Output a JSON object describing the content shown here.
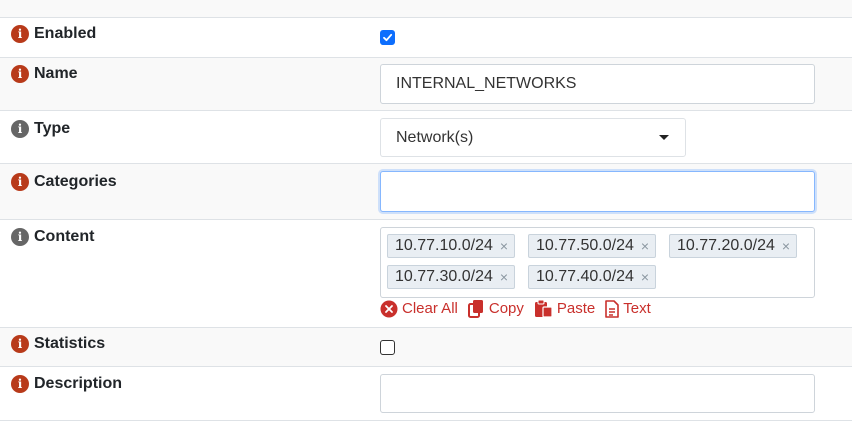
{
  "fields": {
    "enabled": {
      "label": "Enabled",
      "checked": true
    },
    "name": {
      "label": "Name",
      "value": "INTERNAL_NETWORKS"
    },
    "type": {
      "label": "Type",
      "value": "Network(s)"
    },
    "categories": {
      "label": "Categories",
      "value": ""
    },
    "content": {
      "label": "Content",
      "tags": [
        "10.77.10.0/24",
        "10.77.50.0/24",
        "10.77.20.0/24",
        "10.77.30.0/24",
        "10.77.40.0/24"
      ],
      "remove_glyph": "×",
      "actions": {
        "clear_all": "Clear All",
        "copy": "Copy",
        "paste": "Paste",
        "text": "Text"
      }
    },
    "statistics": {
      "label": "Statistics",
      "checked": false
    },
    "description": {
      "label": "Description",
      "value": ""
    }
  },
  "colors": {
    "info_red": "#b83a1a",
    "info_grey": "#666666",
    "action_red": "#c9302c",
    "checkbox_blue": "#0d6efd"
  },
  "icons": {
    "info": "info-circle-icon",
    "clear_all": "x-circle-icon",
    "copy": "copy-icon",
    "paste": "paste-icon",
    "text": "file-text-icon",
    "dropdown": "caret-down-icon"
  }
}
